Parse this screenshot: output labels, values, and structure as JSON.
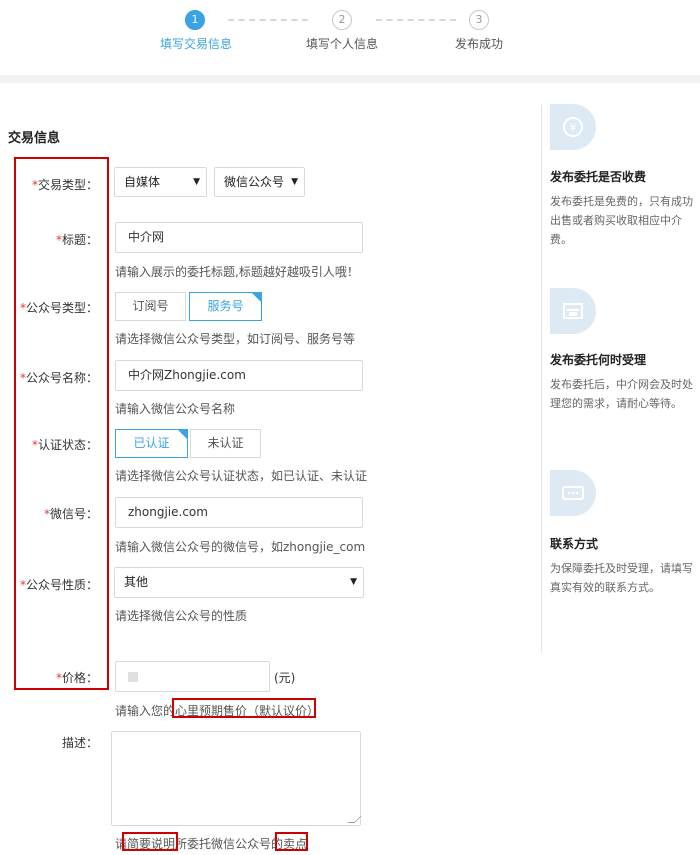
{
  "steps": [
    {
      "num": "1",
      "label": "填写交易信息"
    },
    {
      "num": "2",
      "label": "填写个人信息"
    },
    {
      "num": "3",
      "label": "发布成功"
    }
  ],
  "section_title": "交易信息",
  "form": {
    "required_mark": "*",
    "trade_type": {
      "label": "交易类型：",
      "category_value": "自媒体",
      "subcategory_value": "微信公众号"
    },
    "title": {
      "label": "标题：",
      "value": "中介网",
      "hint": "请输入展示的委托标题,标题越好越吸引人哦！"
    },
    "account_type": {
      "label": "公众号类型：",
      "options": [
        "订阅号",
        "服务号"
      ],
      "selected": "服务号",
      "hint": "请选择微信公众号类型，如订阅号、服务号等"
    },
    "account_name": {
      "label": "公众号名称：",
      "value": "中介网Zhongjie.com",
      "hint": "请输入微信公众号名称"
    },
    "verify_status": {
      "label": "认证状态：",
      "options": [
        "已认证",
        "未认证"
      ],
      "selected": "已认证",
      "hint": "请选择微信公众号认证状态，如已认证、未认证"
    },
    "wechat_id": {
      "label": "微信号：",
      "value": "zhongjie.com",
      "hint": "请输入微信公众号的微信号，如zhongjie_com"
    },
    "account_nature": {
      "label": "公众号性质：",
      "value": "其他",
      "hint": "请选择微信公众号的性质"
    },
    "price": {
      "label": "价格：",
      "unit": "(元)",
      "hint_prefix": "请输入您的",
      "hint_highlight": "心里预期售价（默认议价）"
    },
    "description": {
      "label": "描述：",
      "hint_a": "请",
      "hint_b": "简要说明",
      "hint_c": "所委托微信公众号的",
      "hint_d": "卖点"
    }
  },
  "sidebar": [
    {
      "icon": "hand-coin-icon",
      "title": "发布委托是否收费",
      "text": "发布委托是免费的，只有成功出售或者购买收取相应中介费。"
    },
    {
      "icon": "document-icon",
      "title": "发布委托何时受理",
      "text": "发布委托后，中介网会及时处理您的需求，请耐心等待。"
    },
    {
      "icon": "contact-card-icon",
      "title": "联系方式",
      "text": "为保障委托及时受理，请填写真实有效的联系方式。"
    }
  ]
}
